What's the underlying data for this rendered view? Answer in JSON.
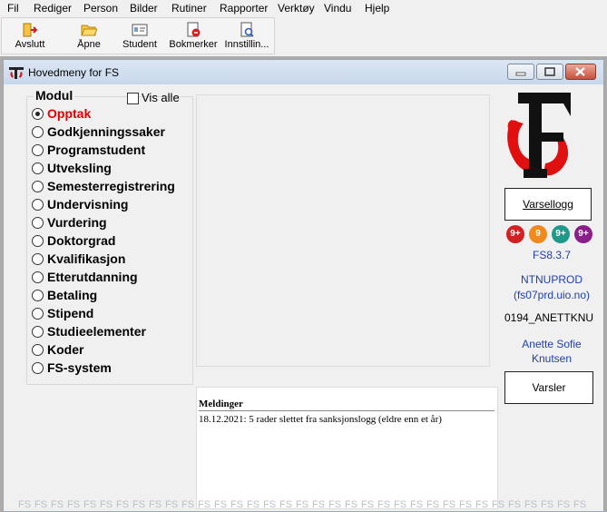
{
  "menu": [
    "Fil",
    "Rediger",
    "Person",
    "Bilder",
    "Rutiner",
    "Rapporter",
    "Verktøy",
    "Vindu",
    "Hjelp"
  ],
  "toolbar": [
    {
      "label": "Avslutt",
      "icon": "exit-icon"
    },
    {
      "label": "Åpne",
      "icon": "folder-open-icon"
    },
    {
      "label": "Student",
      "icon": "id-card-icon"
    },
    {
      "label": "Bokmerker",
      "icon": "bookmark-icon"
    },
    {
      "label": "Innstillin...",
      "icon": "settings-document-icon"
    }
  ],
  "window": {
    "title": "Hovedmeny for FS"
  },
  "modul": {
    "title": "Modul",
    "vis_alle": "Vis alle",
    "items": [
      "Opptak",
      "Godkjenningssaker",
      "Programstudent",
      "Utveksling",
      "Semesterregistrering",
      "Undervisning",
      "Vurdering",
      "Doktorgrad",
      "Kvalifikasjon",
      "Etterutdanning",
      "Betaling",
      "Stipend",
      "Studieelementer",
      "Koder",
      "FS-system"
    ],
    "selected": "Opptak"
  },
  "messages": {
    "header": "Meldinger",
    "lines": [
      "18.12.2021: 5 rader slettet fra sanksjonslogg (eldre enn et år)"
    ]
  },
  "right": {
    "varsellogg": "Varsellogg",
    "badges": [
      {
        "text": "9+",
        "color": "#d42020"
      },
      {
        "text": "9",
        "color": "#f08a1c"
      },
      {
        "text": "9+",
        "color": "#1f9a8a"
      },
      {
        "text": "9+",
        "color": "#8a1f8a"
      }
    ],
    "version": "FS8.3.7",
    "db": "NTNUPROD",
    "host": "(fs07prd.uio.no)",
    "user_id": "0194_ANETTKNU",
    "user_name_1": "Anette Sofie",
    "user_name_2": "Knutsen",
    "varsler": "Varsler"
  },
  "watermark": "FS"
}
